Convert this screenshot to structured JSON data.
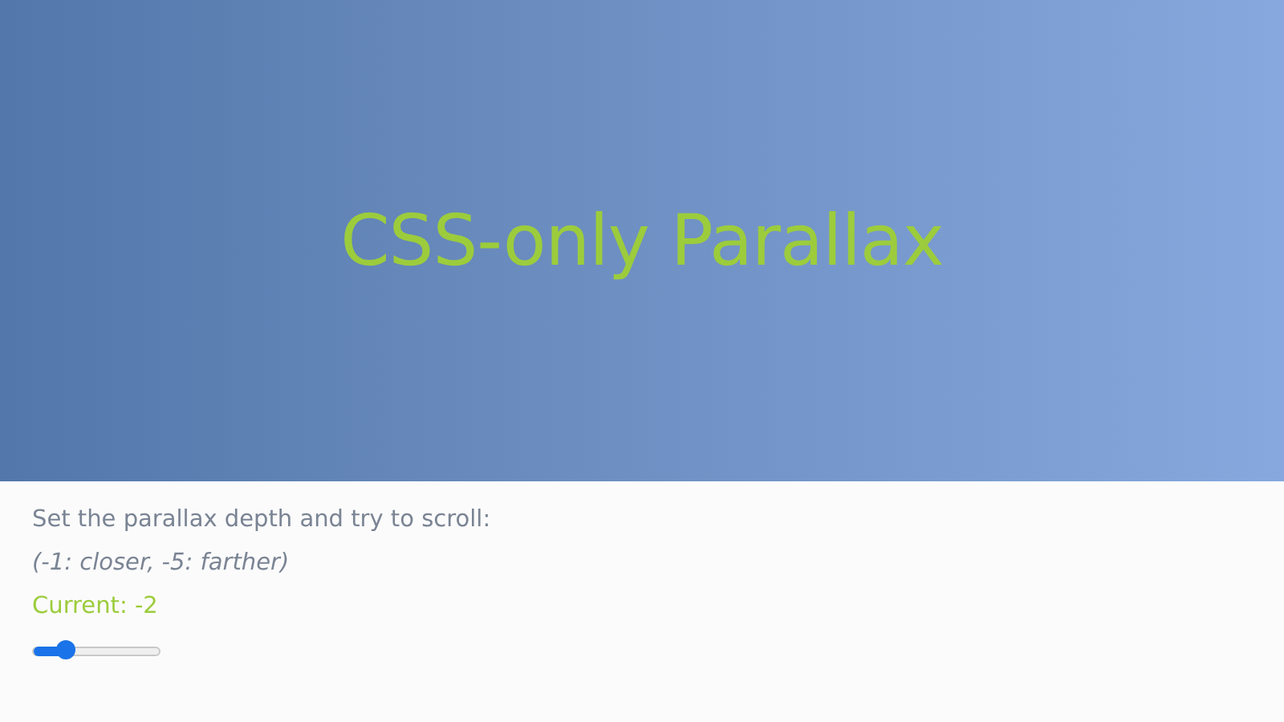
{
  "hero": {
    "title": "CSS-only Parallax"
  },
  "controls": {
    "instruction": "Set the parallax depth and try to scroll:",
    "hint": "(-1: closer, -5: farther)",
    "current": "Current: -2",
    "depth_slider": {
      "level": 0.25
    }
  }
}
